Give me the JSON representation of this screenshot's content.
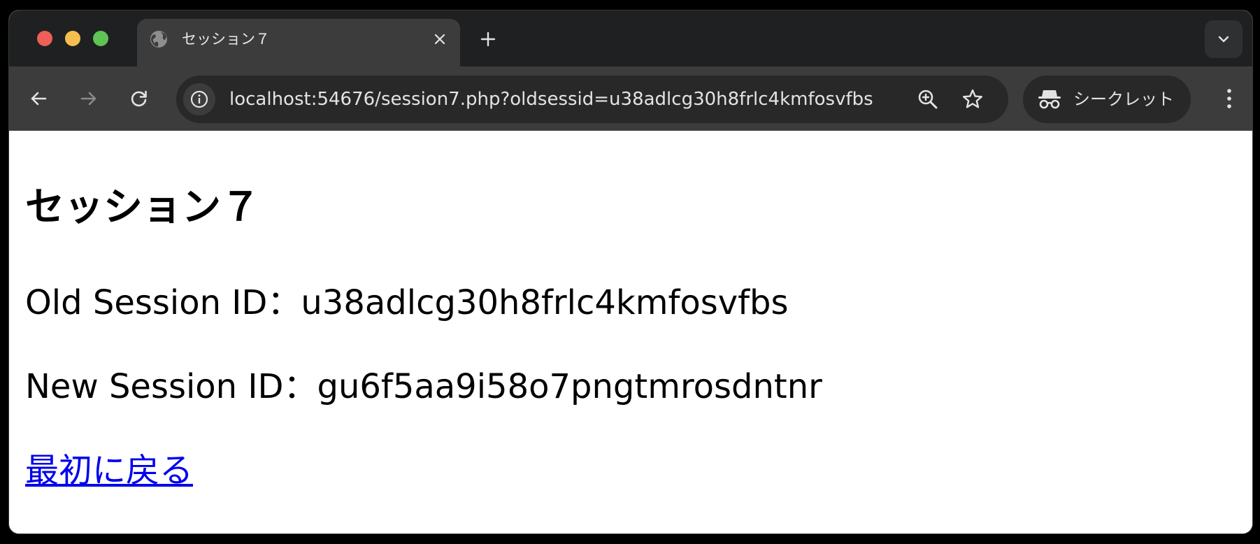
{
  "browser": {
    "tab": {
      "title": "セッション７",
      "favicon": "globe-icon"
    },
    "address_bar": {
      "url": "localhost:54676/session7.php?oldsessid=u38adlcg30h8frlc4kmfosvfbs"
    },
    "incognito_label": "シークレット",
    "colors": {
      "tabstrip_bg": "#1f2021",
      "toolbar_bg": "#3c3c3c",
      "omnibox_bg": "#282828",
      "traffic_red": "#ed5f57",
      "traffic_yellow": "#f5bf4f",
      "traffic_green": "#5fc454"
    }
  },
  "page": {
    "heading": "セッション７",
    "old_session": {
      "label": "Old Session ID：",
      "value": "u38adlcg30h8frlc4kmfosvfbs"
    },
    "new_session": {
      "label": "New Session ID：",
      "value": "gu6f5aa9i58o7pngtmrosdntnr"
    },
    "back_link": "最初に戻る",
    "link_color": "#0000ee"
  }
}
